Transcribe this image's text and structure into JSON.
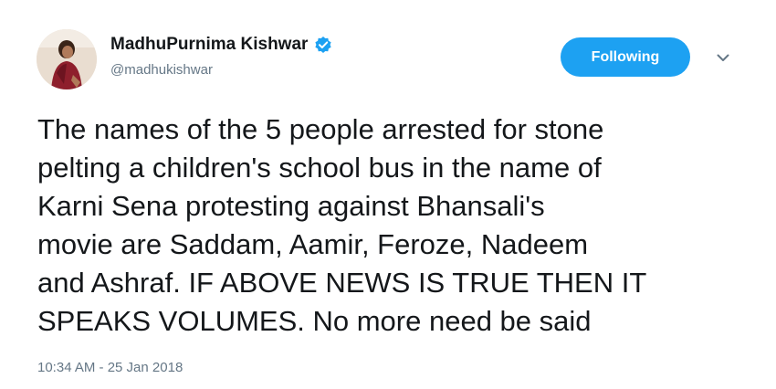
{
  "user": {
    "display_name": "MadhuPurnima Kishwar",
    "handle": "@madhukishwar",
    "verified": true,
    "avatar_icon": "profile-photo"
  },
  "follow_button": {
    "label": "Following",
    "color": "#1da1f2"
  },
  "menu": {
    "icon": "chevron-down-icon"
  },
  "tweet": {
    "lines": [
      "The names of the 5 people arrested for stone",
      "pelting a children's school bus in the name of",
      "Karni Sena protesting against Bhansali's",
      "movie are Saddam, Aamir, Feroze, Nadeem",
      "and Ashraf. IF ABOVE NEWS IS TRUE THEN IT",
      "SPEAKS VOLUMES. No more need be said"
    ],
    "timestamp": "10:34 AM - 25 Jan 2018"
  },
  "colors": {
    "accent": "#1da1f2",
    "text": "#14171a",
    "muted": "#657786"
  }
}
